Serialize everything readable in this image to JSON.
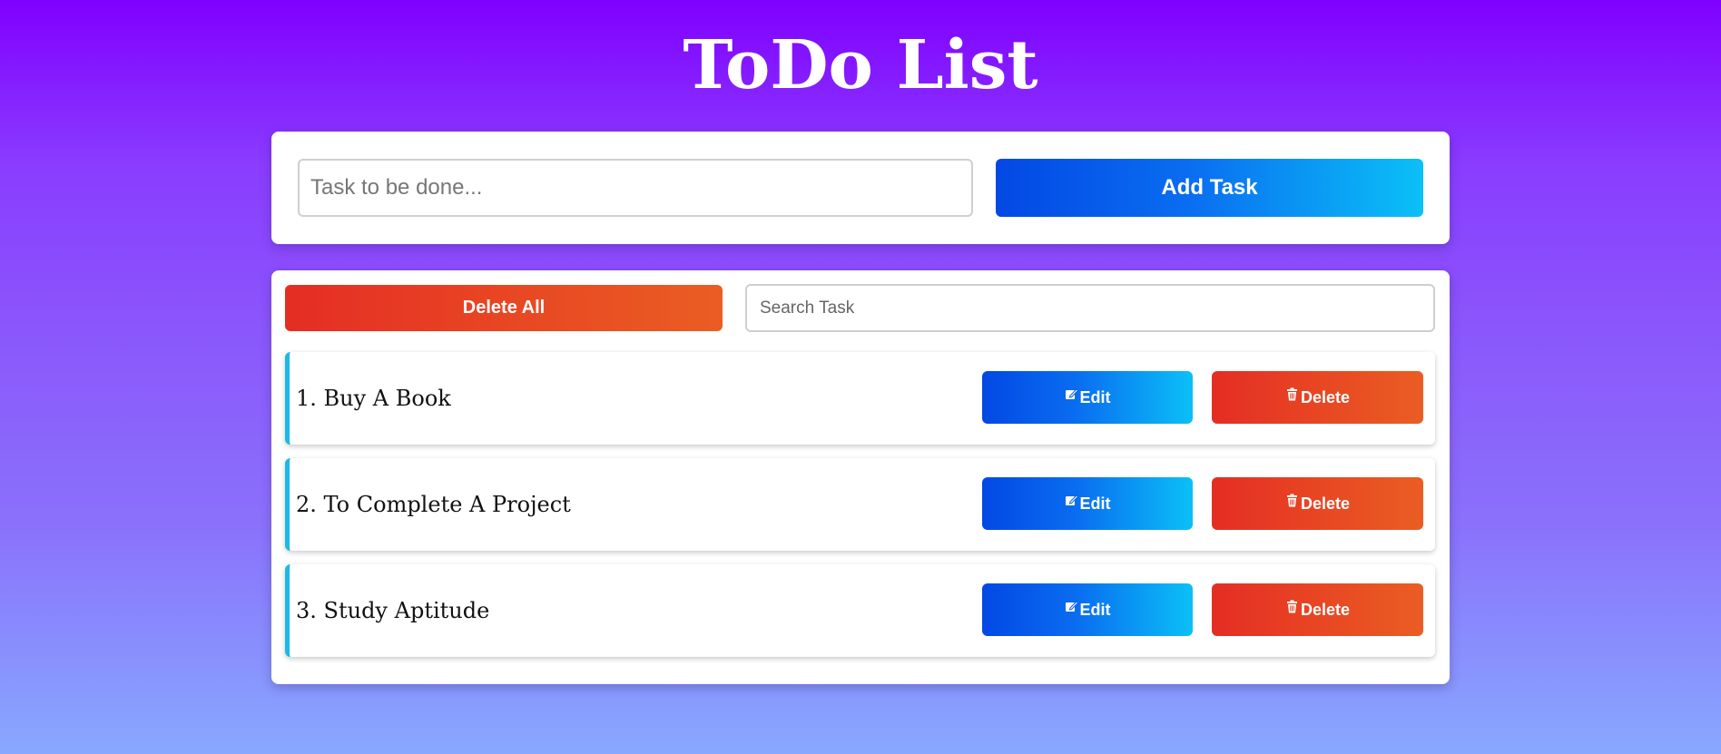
{
  "header": {
    "title": "ToDo List"
  },
  "add_task": {
    "input_value": "",
    "input_placeholder": "Task to be done...",
    "button_label": "Add Task"
  },
  "controls": {
    "delete_all_label": "Delete All",
    "search_value": "",
    "search_placeholder": "Search Task"
  },
  "tasks": [
    {
      "text": "1. Buy A Book",
      "edit_label": "Edit",
      "delete_label": "Delete"
    },
    {
      "text": "2. To Complete A Project",
      "edit_label": "Edit",
      "delete_label": "Delete"
    },
    {
      "text": "3. Study Aptitude",
      "edit_label": "Edit",
      "delete_label": "Delete"
    }
  ],
  "icons": {
    "edit": "edit-icon",
    "delete": "trash-icon"
  },
  "colors": {
    "background_top": "#8000ff",
    "background_bottom": "#88a8ff",
    "primary_gradient_start": "#0348e4",
    "primary_gradient_end": "#0bc0f7",
    "danger_gradient_start": "#e42d24",
    "danger_gradient_end": "#ea5d23",
    "task_accent": "#1bb9e7"
  }
}
